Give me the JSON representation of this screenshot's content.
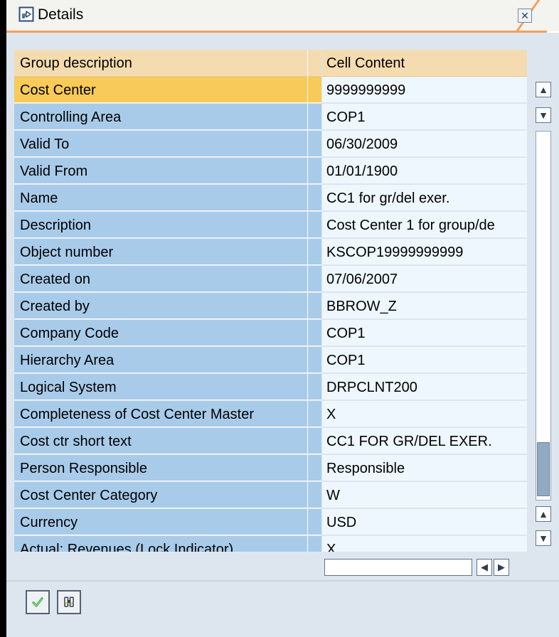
{
  "window": {
    "title": "Details",
    "close_icon": "close-icon"
  },
  "table": {
    "headers": [
      "Group description",
      "Cell Content"
    ],
    "rows": [
      {
        "label": "Cost Center",
        "value": "9999999999"
      },
      {
        "label": "Controlling Area",
        "value": "COP1"
      },
      {
        "label": "Valid To",
        "value": "06/30/2009"
      },
      {
        "label": "Valid From",
        "value": "01/01/1900"
      },
      {
        "label": "Name",
        "value": "CC1 for gr/del exer."
      },
      {
        "label": "Description",
        "value": "Cost Center 1 for group/de"
      },
      {
        "label": "Object number",
        "value": "KSCOP19999999999"
      },
      {
        "label": "Created on",
        "value": "07/06/2007"
      },
      {
        "label": "Created by",
        "value": "BBROW_Z"
      },
      {
        "label": "Company Code",
        "value": "COP1"
      },
      {
        "label": "Hierarchy Area",
        "value": "COP1"
      },
      {
        "label": "Logical System",
        "value": "DRPCLNT200"
      },
      {
        "label": "Completeness of Cost Center Master",
        "value": "X"
      },
      {
        "label": "Cost ctr short text",
        "value": "CC1 FOR GR/DEL EXER."
      },
      {
        "label": "Person Responsible",
        "value": "Responsible"
      },
      {
        "label": "Cost Center Category",
        "value": "W"
      },
      {
        "label": "Currency",
        "value": "USD"
      },
      {
        "label": "Actual: Revenues (Lock Indicator)",
        "value": "X"
      }
    ]
  },
  "scrollbar": {
    "vertical_up_icon": "triangle-up-icon",
    "vertical_down_icon": "triangle-down-icon",
    "horizontal_left_icon": "triangle-left-icon",
    "horizontal_right_icon": "triangle-right-icon"
  },
  "footer": {
    "buttons": [
      {
        "icon": "checkmark-icon"
      },
      {
        "icon": "binoculars-icon"
      }
    ]
  },
  "colors": {
    "window_bg": "#dde6ef",
    "header_bg": "#f4dcb0",
    "label_bg": "#a9cbea",
    "value_bg": "#eef7fd",
    "selected_bg": "#f7ca5a",
    "accent": "#f4a15a"
  }
}
